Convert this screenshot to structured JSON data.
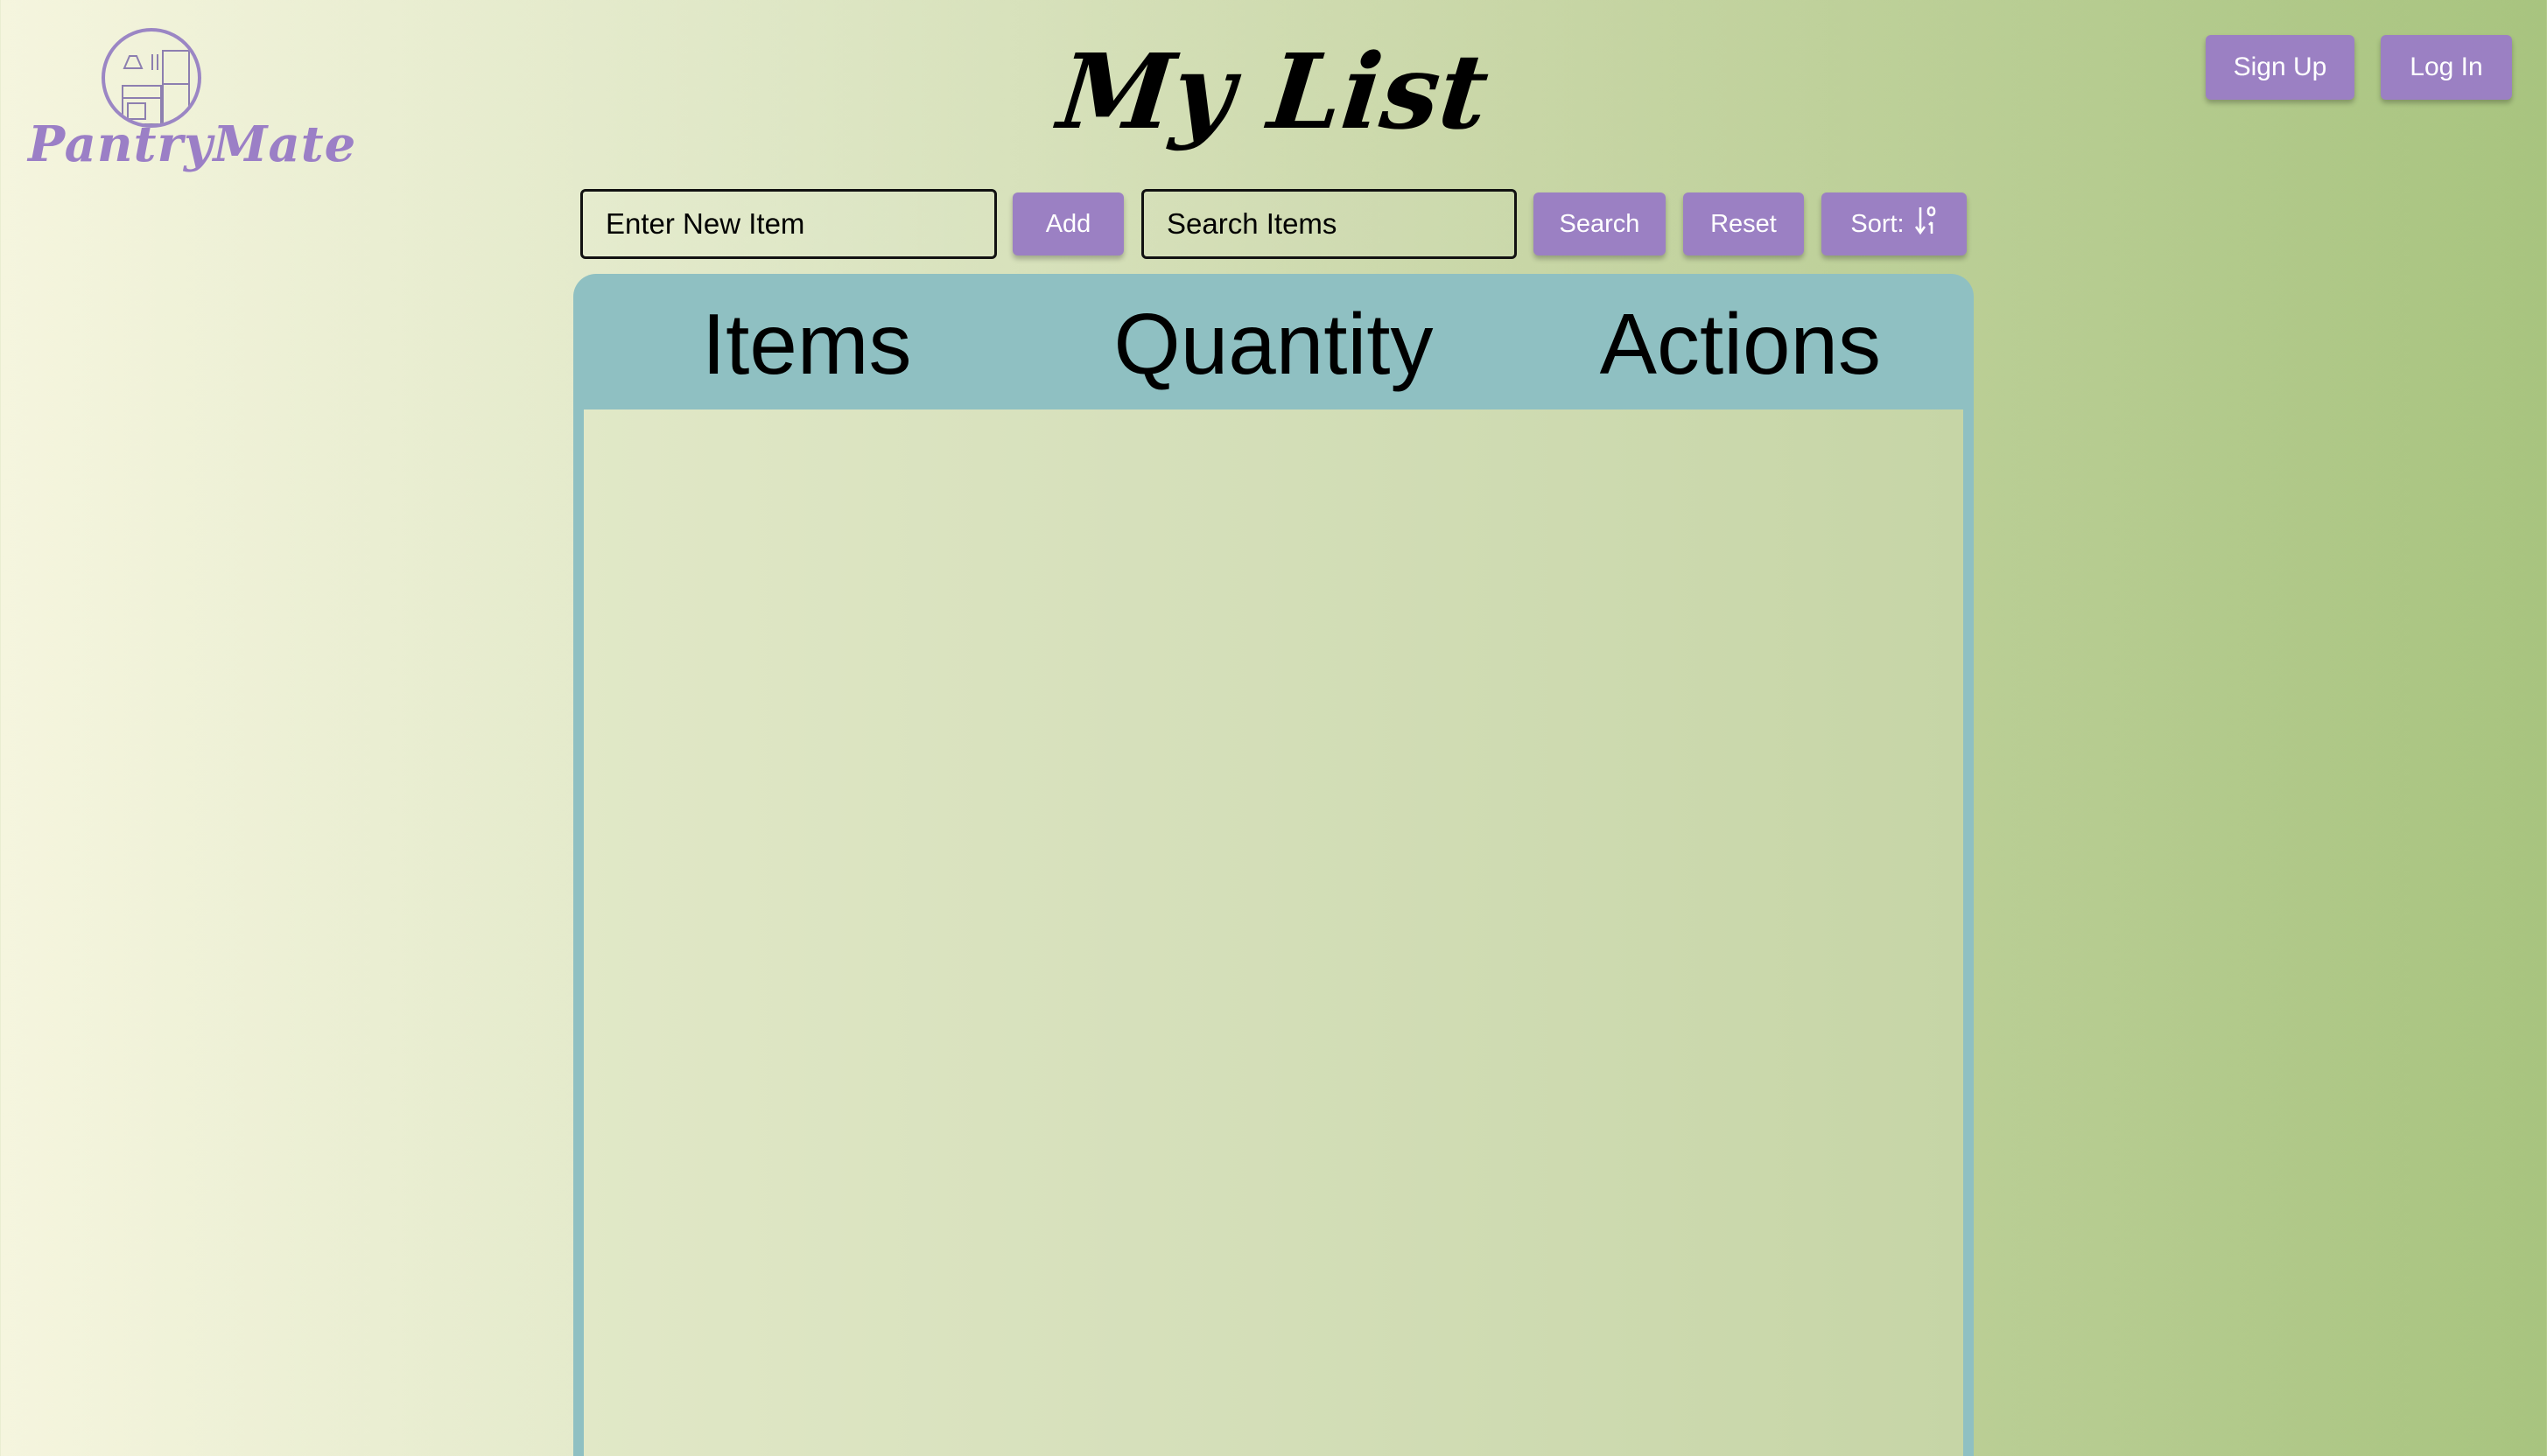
{
  "brand": {
    "name": "PantryMate",
    "logo_icon": "kitchen-icon",
    "accent_color": "#9b80c3"
  },
  "header": {
    "title": "My List",
    "signup_label": "Sign Up",
    "login_label": "Log In"
  },
  "toolbar": {
    "new_item_placeholder": "Enter New Item",
    "new_item_value": "",
    "add_label": "Add",
    "search_placeholder": "Search Items",
    "search_value": "",
    "search_label": "Search",
    "reset_label": "Reset",
    "sort_label": "Sort:",
    "sort_icon": "sort-icon"
  },
  "table": {
    "columns": [
      "Items",
      "Quantity",
      "Actions"
    ],
    "rows": [],
    "header_color": "#8fc0c2"
  }
}
